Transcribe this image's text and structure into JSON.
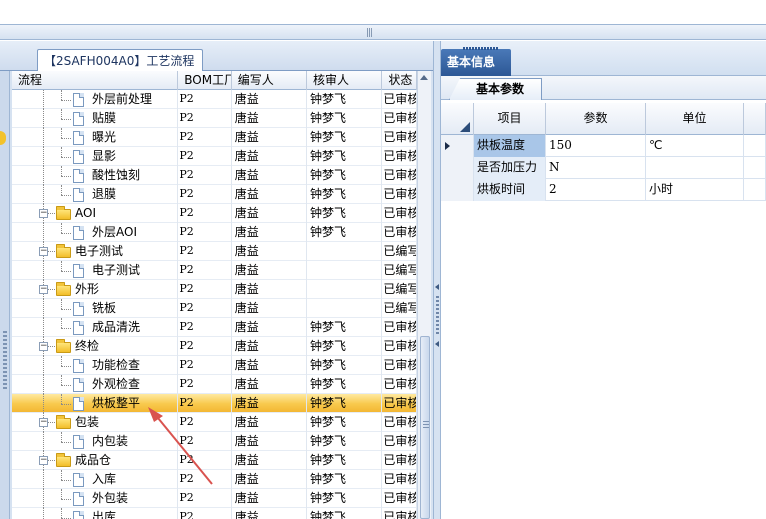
{
  "splitter": {
    "grip": "|||"
  },
  "left_panel": {
    "tab_label": "【2SAFH004A0】工艺流程",
    "columns": [
      "流程",
      "BOM工厂",
      "编写人",
      "核审人",
      "状态"
    ],
    "rows": [
      {
        "name": "外层前处理",
        "type": "doc",
        "level": 2,
        "bom": "P2",
        "writer": "唐益",
        "reviewer": "钟梦飞",
        "status": "已审核"
      },
      {
        "name": "贴膜",
        "type": "doc",
        "level": 2,
        "bom": "P2",
        "writer": "唐益",
        "reviewer": "钟梦飞",
        "status": "已审核"
      },
      {
        "name": "曝光",
        "type": "doc",
        "level": 2,
        "bom": "P2",
        "writer": "唐益",
        "reviewer": "钟梦飞",
        "status": "已审核"
      },
      {
        "name": "显影",
        "type": "doc",
        "level": 2,
        "bom": "P2",
        "writer": "唐益",
        "reviewer": "钟梦飞",
        "status": "已审核"
      },
      {
        "name": "酸性蚀刻",
        "type": "doc",
        "level": 2,
        "bom": "P2",
        "writer": "唐益",
        "reviewer": "钟梦飞",
        "status": "已审核"
      },
      {
        "name": "退膜",
        "type": "doc",
        "level": 2,
        "bom": "P2",
        "writer": "唐益",
        "reviewer": "钟梦飞",
        "status": "已审核"
      },
      {
        "name": "AOI",
        "type": "folder",
        "level": 1,
        "bom": "P2",
        "writer": "唐益",
        "reviewer": "钟梦飞",
        "status": "已审核"
      },
      {
        "name": "外层AOI",
        "type": "doc",
        "level": 2,
        "bom": "P2",
        "writer": "唐益",
        "reviewer": "钟梦飞",
        "status": "已审核"
      },
      {
        "name": "电子测试",
        "type": "folder",
        "level": 1,
        "bom": "P2",
        "writer": "唐益",
        "reviewer": "",
        "status": "已编写"
      },
      {
        "name": "电子测试",
        "type": "doc",
        "level": 2,
        "bom": "P2",
        "writer": "唐益",
        "reviewer": "",
        "status": "已编写"
      },
      {
        "name": "外形",
        "type": "folder",
        "level": 1,
        "bom": "P2",
        "writer": "唐益",
        "reviewer": "",
        "status": "已编写"
      },
      {
        "name": "铣板",
        "type": "doc",
        "level": 2,
        "bom": "P2",
        "writer": "唐益",
        "reviewer": "",
        "status": "已编写"
      },
      {
        "name": "成品清洗",
        "type": "doc",
        "level": 2,
        "bom": "P2",
        "writer": "唐益",
        "reviewer": "钟梦飞",
        "status": "已审核"
      },
      {
        "name": "终检",
        "type": "folder",
        "level": 1,
        "bom": "P2",
        "writer": "唐益",
        "reviewer": "钟梦飞",
        "status": "已审核"
      },
      {
        "name": "功能检查",
        "type": "doc",
        "level": 2,
        "bom": "P2",
        "writer": "唐益",
        "reviewer": "钟梦飞",
        "status": "已审核"
      },
      {
        "name": "外观检查",
        "type": "doc",
        "level": 2,
        "bom": "P2",
        "writer": "唐益",
        "reviewer": "钟梦飞",
        "status": "已审核"
      },
      {
        "name": "烘板整平",
        "type": "doc",
        "level": 2,
        "bom": "P2",
        "writer": "唐益",
        "reviewer": "钟梦飞",
        "status": "已审核",
        "selected": true
      },
      {
        "name": "包装",
        "type": "folder",
        "level": 1,
        "bom": "P2",
        "writer": "唐益",
        "reviewer": "钟梦飞",
        "status": "已审核"
      },
      {
        "name": "内包装",
        "type": "doc",
        "level": 2,
        "bom": "P2",
        "writer": "唐益",
        "reviewer": "钟梦飞",
        "status": "已审核"
      },
      {
        "name": "成品仓",
        "type": "folder",
        "level": 1,
        "bom": "P2",
        "writer": "唐益",
        "reviewer": "钟梦飞",
        "status": "已审核"
      },
      {
        "name": "入库",
        "type": "doc",
        "level": 2,
        "bom": "P2",
        "writer": "唐益",
        "reviewer": "钟梦飞",
        "status": "已审核"
      },
      {
        "name": "外包装",
        "type": "doc",
        "level": 2,
        "bom": "P2",
        "writer": "唐益",
        "reviewer": "钟梦飞",
        "status": "已审核"
      },
      {
        "name": "出库",
        "type": "doc",
        "level": 2,
        "bom": "P2",
        "writer": "唐益",
        "reviewer": "钟梦飞",
        "status": "已审核"
      }
    ]
  },
  "right_panel": {
    "tab_label": "基本信息",
    "subtab_label": "基本参数",
    "columns": [
      "项目",
      "参数",
      "单位"
    ],
    "rows": [
      {
        "item": "烘板温度",
        "param": "150",
        "unit": "℃",
        "current": true
      },
      {
        "item": "是否加压力",
        "param": "N",
        "unit": ""
      },
      {
        "item": "烘板时间",
        "param": "2",
        "unit": "小时"
      }
    ]
  },
  "colors": {
    "accent": "#2c5795",
    "selected_row": "#f8c94d",
    "annotation_arrow": "#d9534f"
  }
}
